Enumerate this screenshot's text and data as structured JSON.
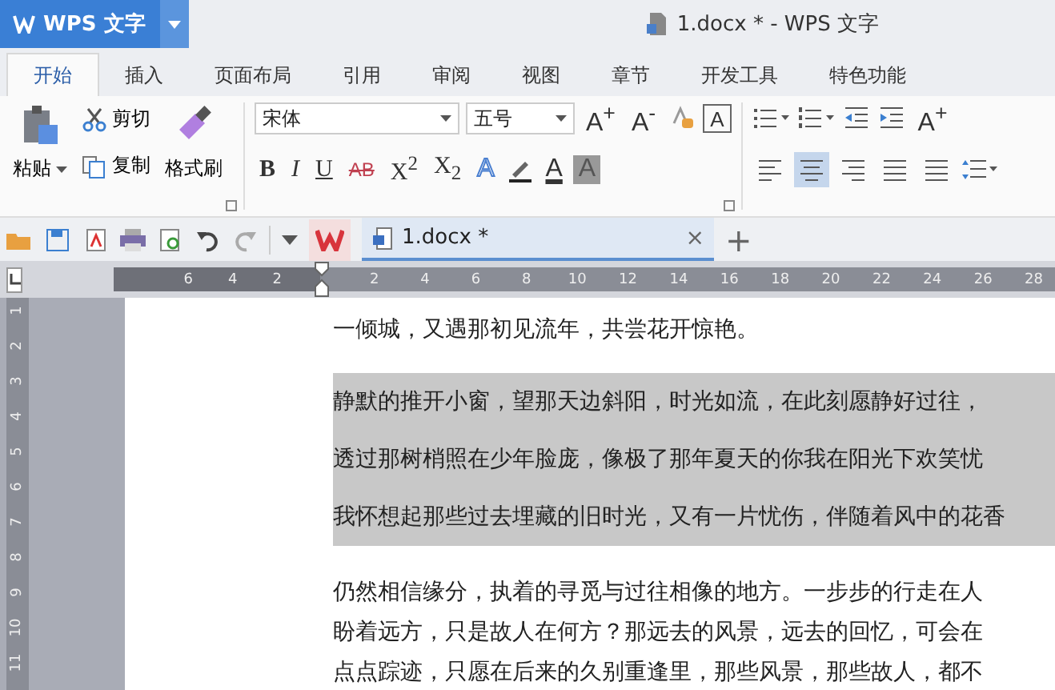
{
  "app_button": {
    "label": "WPS 文字"
  },
  "window": {
    "title": "1.docx * - WPS 文字"
  },
  "tabs": [
    {
      "label": "开始",
      "selected": true
    },
    {
      "label": "插入",
      "selected": false
    },
    {
      "label": "页面布局",
      "selected": false
    },
    {
      "label": "引用",
      "selected": false
    },
    {
      "label": "审阅",
      "selected": false
    },
    {
      "label": "视图",
      "selected": false
    },
    {
      "label": "章节",
      "selected": false
    },
    {
      "label": "开发工具",
      "selected": false
    },
    {
      "label": "特色功能",
      "selected": false
    }
  ],
  "clipboard": {
    "paste": "粘贴",
    "cut": "剪切",
    "copy": "复制",
    "format_painter": "格式刷"
  },
  "font": {
    "name": "宋体",
    "size": "五号"
  },
  "size_buttons": [
    {
      "label": "A$^{+}$"
    },
    {
      "label": "A$^{-}$"
    }
  ],
  "format_buttons": [
    {
      "kind": "bold",
      "label": "B"
    },
    {
      "kind": "italic",
      "label": "I"
    },
    {
      "kind": "underline",
      "label": "U"
    },
    {
      "kind": "strike",
      "label": "AB"
    },
    {
      "kind": "super",
      "label": "X$^{2}$"
    },
    {
      "kind": "sub",
      "label": "X$_{2}$"
    }
  ],
  "effect_buttons": [
    {
      "kind": "text-effect",
      "label": "A"
    },
    {
      "kind": "font-color",
      "label": "A"
    },
    {
      "kind": "shading",
      "label": "A"
    }
  ],
  "char_border": {
    "label": "A"
  },
  "grow_button": {
    "label": "A$^{+}$"
  },
  "alignment": [
    {
      "selected": false
    },
    {
      "selected": true
    },
    {
      "selected": false
    },
    {
      "selected": false
    },
    {
      "selected": false
    }
  ],
  "document_tab": {
    "label": "1.docx *",
    "close": "×"
  },
  "new_tab": "+",
  "ruler": {
    "left_ticks": [
      "6",
      "4",
      "2"
    ],
    "right_ticks": [
      "2",
      "4",
      "6",
      "8",
      "10",
      "12",
      "14",
      "16",
      "18",
      "20",
      "22",
      "24",
      "26",
      "28"
    ]
  },
  "vertical_ruler": [
    "1",
    "2",
    "3",
    "4",
    "5",
    "6",
    "7",
    "8",
    "9",
    "10",
    "11"
  ],
  "paragraphs": [
    {
      "selected": false,
      "lines": [
        "一倾城，又遇那初见流年，共尝花开惊艳。"
      ]
    },
    {
      "selected": true,
      "lines": [
        "静默的推开小窗，望那天边斜阳，时光如流，在此刻愿静好过往，",
        "透过那树梢照在少年脸庞，像极了那年夏天的你我在阳光下欢笑忧",
        "我怀想起那些过去埋藏的旧时光，又有一片忧伤，伴随着风中的花香"
      ]
    },
    {
      "selected": false,
      "lines": [
        "仍然相信缘分，执着的寻觅与过往相像的地方。一步步的行走在人",
        "盼着远方，只是故人在何方？那远去的风景，远去的回忆，可会在",
        "点点踪迹，只愿在后来的久别重逢里，那些风景，那些故人，都不"
      ]
    }
  ]
}
